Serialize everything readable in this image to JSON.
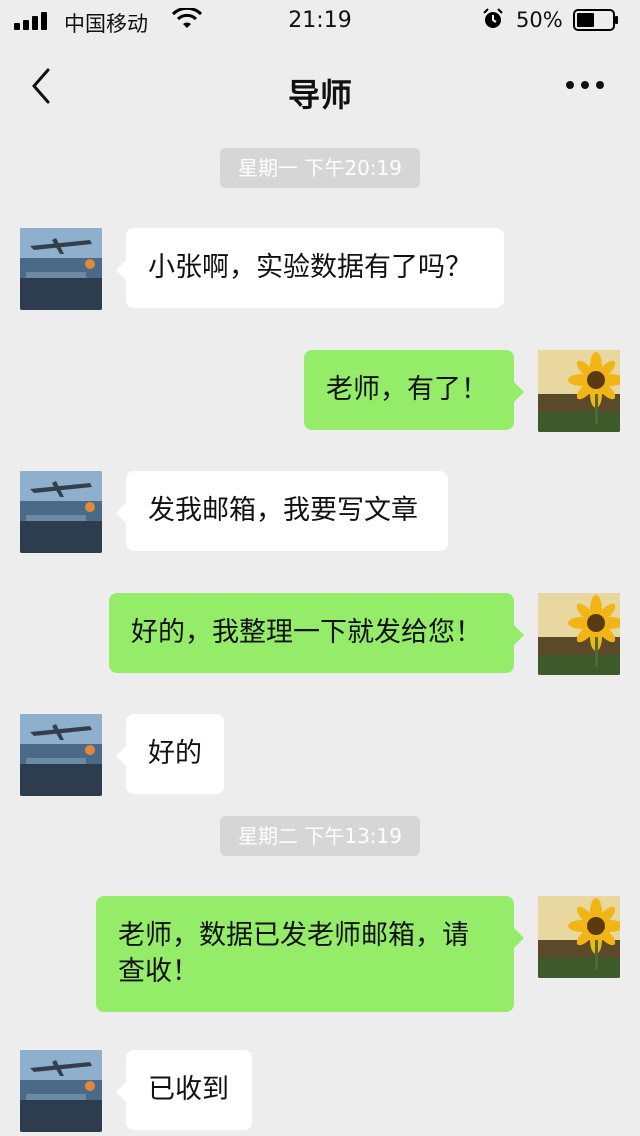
{
  "status_bar": {
    "carrier": "中国移动",
    "time": "21:19",
    "battery": "50%",
    "battery_level": 0.5
  },
  "header": {
    "title": "导师",
    "back_icon": "chevron-left-icon",
    "more_icon": "ellipsis-icon"
  },
  "colors": {
    "background": "#ededed",
    "bubble_self": "#95ec69",
    "bubble_other": "#ffffff",
    "time_tag": "#d6d6d6"
  },
  "messages": [
    {
      "type": "time",
      "text": "星期一 下午20:19"
    },
    {
      "type": "msg",
      "side": "left",
      "text": "小张啊，实验数据有了吗？"
    },
    {
      "type": "msg",
      "side": "right",
      "text": "老师，有了！"
    },
    {
      "type": "msg",
      "side": "left",
      "text": "发我邮箱，我要写文章"
    },
    {
      "type": "msg",
      "side": "right",
      "text": "好的，我整理一下就发给您！"
    },
    {
      "type": "msg",
      "side": "left",
      "text": "好的"
    },
    {
      "type": "time",
      "text": "星期二 下午13:19"
    },
    {
      "type": "msg",
      "side": "right",
      "text": "老师，数据已发老师邮箱，请查收！"
    },
    {
      "type": "msg",
      "side": "left",
      "text": "已收到"
    }
  ]
}
